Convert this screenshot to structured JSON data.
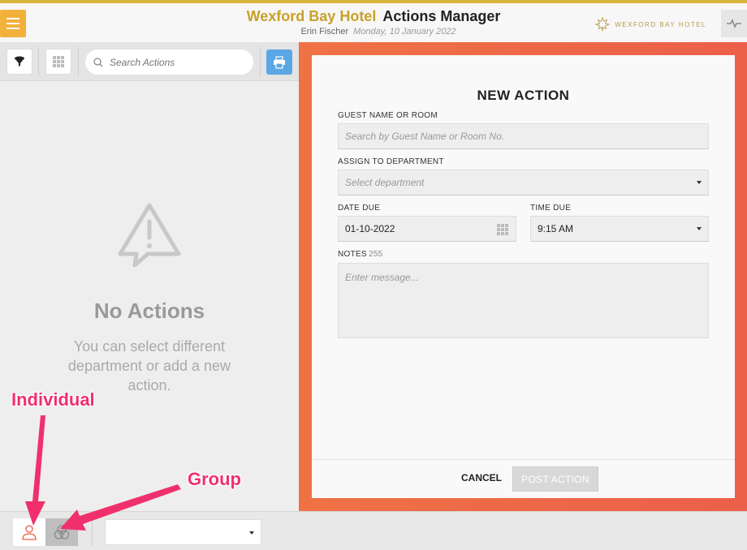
{
  "header": {
    "hotel_name": "Wexford Bay Hotel",
    "app_name": "Actions Manager",
    "user_name": "Erin Fischer",
    "date": "Monday, 10 January 2022",
    "brand_text": "WEXFORD BAY HOTEL",
    "accent_color": "#d9b43a",
    "menu_icon": "menu-icon",
    "activity_icon": "activity-icon"
  },
  "left_panel": {
    "search_placeholder": "Search Actions",
    "empty_title": "No Actions",
    "empty_message": "You can select different department or add a new action."
  },
  "form": {
    "title": "NEW ACTION",
    "guest_label": "GUEST NAME OR ROOM",
    "guest_placeholder": "Search by Guest Name or Room No.",
    "department_label": "ASSIGN TO DEPARTMENT",
    "department_placeholder": "Select department",
    "date_label": "DATE DUE",
    "date_value": "01-10-2022",
    "time_label": "TIME DUE",
    "time_value": "9:15 AM",
    "notes_label": "NOTES",
    "notes_count": "255",
    "notes_placeholder": "Enter message...",
    "cancel_label": "CANCEL",
    "post_label": "POST ACTION",
    "panel_color": "#ec6a47"
  },
  "bottom_bar": {
    "selected_value": ""
  },
  "annotations": {
    "individual": "Individual",
    "group": "Group",
    "color": "#f0306d"
  }
}
